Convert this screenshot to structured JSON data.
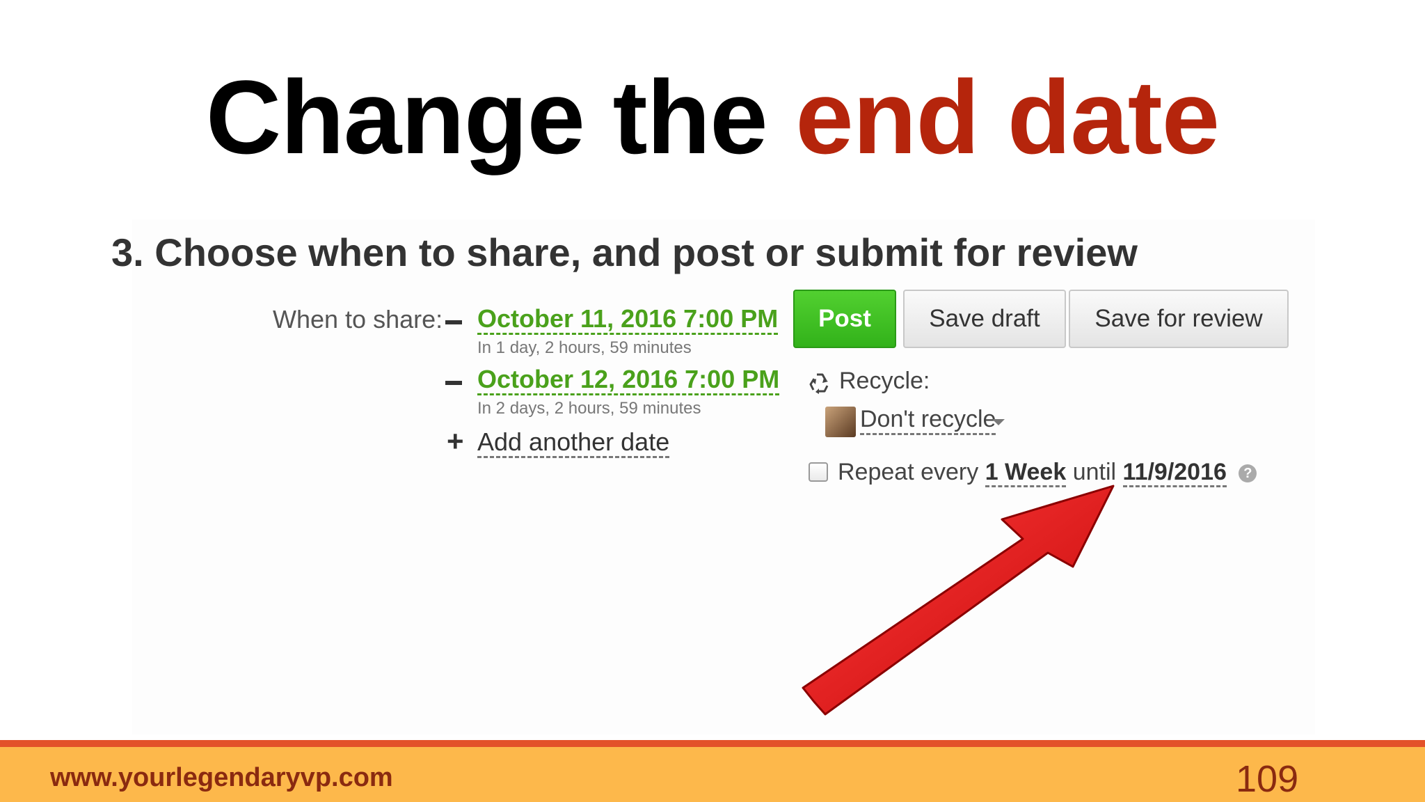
{
  "slide": {
    "title_prefix": "Change the",
    "title_highlight": "end date"
  },
  "form": {
    "heading": "3. Choose when to share, and post or submit for review",
    "when_label": "When to share:",
    "dates": [
      {
        "date": "October 11, 2016 7:00 PM",
        "relative": "In 1 day, 2 hours, 59 minutes"
      },
      {
        "date": "October 12, 2016 7:00 PM",
        "relative": "In 2 days, 2 hours, 59 minutes"
      }
    ],
    "add_date": "Add another date",
    "buttons": {
      "post": "Post",
      "save_draft": "Save draft",
      "save_review": "Save for review"
    },
    "recycle_label": "Recycle:",
    "recycle_value": "Don't recycle",
    "repeat": {
      "prefix": "Repeat every",
      "interval": "1 Week",
      "until_word": "until",
      "end_date": "11/9/2016",
      "checked": false
    }
  },
  "footer": {
    "url": "www.yourlegendaryvp.com",
    "page": "109"
  },
  "colors": {
    "title_accent": "#b5250c",
    "date_link": "#4aa11b",
    "post_button": "#3bbd20",
    "arrow": "#e01010",
    "footer_band": "#fdb84b",
    "footer_rule": "#e3522a",
    "footer_text": "#8a2a10"
  },
  "icons": [
    "recycle-icon",
    "help-icon",
    "minus-icon",
    "plus-icon",
    "avatar",
    "caret-down-icon",
    "arrow-pointer"
  ]
}
